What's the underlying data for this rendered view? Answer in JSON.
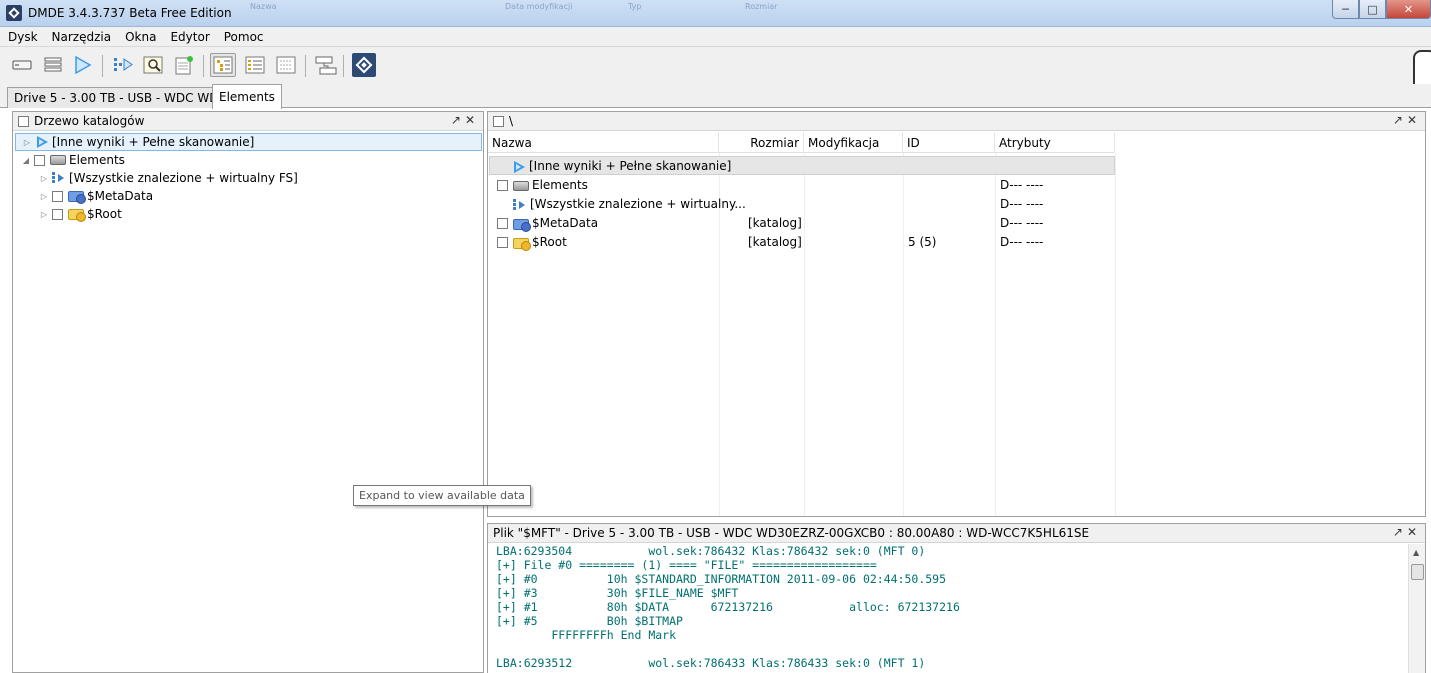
{
  "window": {
    "title": "DMDE 3.4.3.737 Beta Free Edition"
  },
  "ghost_header": [
    "Nazwa",
    "Data modyfikacji",
    "Typ",
    "Rozmiar"
  ],
  "menu": [
    "Dysk",
    "Narzędzia",
    "Okna",
    "Edytor",
    "Pomoc"
  ],
  "tabs": [
    {
      "label": "Drive 5 - 3.00 TB - USB - WDC WD3..."
    },
    {
      "label": "Elements"
    }
  ],
  "tree_panel": {
    "title": "Drzewo katalogów",
    "items": [
      {
        "label": "[Inne wyniki + Pełne skanowanie]"
      },
      {
        "label": "Elements"
      },
      {
        "label": "[Wszystkie znalezione + wirtualny FS]"
      },
      {
        "label": "$MetaData"
      },
      {
        "label": "$Root"
      }
    ]
  },
  "list_panel": {
    "path": "\\",
    "columns": [
      "Nazwa",
      "Rozmiar",
      "Modyfikacja",
      "ID",
      "Atrybuty"
    ],
    "rows": [
      {
        "name": "[Inne wyniki + Pełne skanowanie]",
        "size": "",
        "mod": "",
        "id": "",
        "attr": ""
      },
      {
        "name": "Elements",
        "size": "",
        "mod": "",
        "id": "",
        "attr": "D--- ----"
      },
      {
        "name": "[Wszystkie znalezione + wirtualny...",
        "size": "",
        "mod": "",
        "id": "",
        "attr": "D--- ----"
      },
      {
        "name": "$MetaData",
        "size": "[katalog]",
        "mod": "",
        "id": "",
        "attr": "D--- ----"
      },
      {
        "name": "$Root",
        "size": "[katalog]",
        "mod": "",
        "id": "5 (5)",
        "attr": "D--- ----"
      }
    ]
  },
  "tooltip": {
    "text": "Expand to view available data"
  },
  "file_panel": {
    "title": "Plik \"$MFT\" - Drive 5 - 3.00 TB - USB - WDC WD30EZRZ-00GXCB0 : 80.00A80 : WD-WCC7K5HL61SE",
    "lines": [
      "LBA:6293504           wol.sek:786432 Klas:786432 sek:0 (MFT 0)",
      "[+] File #0 ======== (1) ==== \"FILE\" ==================",
      "[+] #0          10h $STANDARD_INFORMATION 2011-09-06 02:44:50.595",
      "[+] #3          30h $FILE_NAME $MFT",
      "[+] #1          80h $DATA      672137216           alloc: 672137216",
      "[+] #5          B0h $BITMAP",
      "        FFFFFFFFh End Mark",
      "",
      "LBA:6293512           wol.sek:786433 Klas:786433 sek:0 (MFT 1)"
    ]
  }
}
